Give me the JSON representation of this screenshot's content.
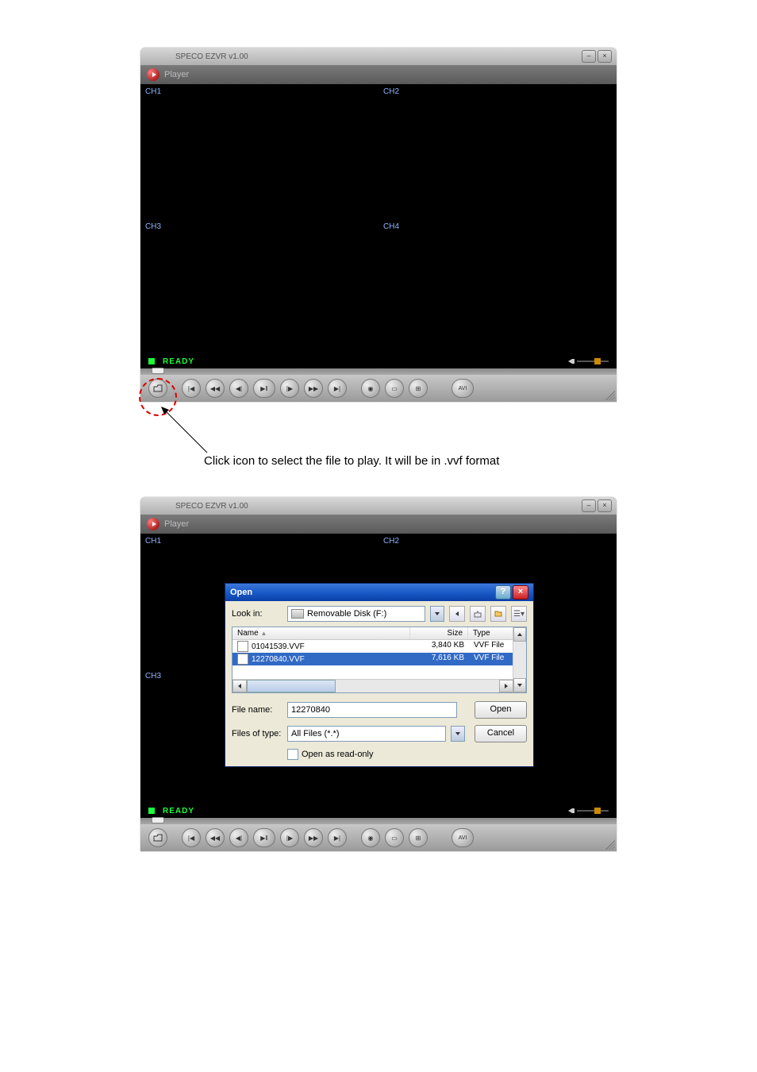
{
  "app": {
    "title": "SPECO EZVR v1.00",
    "player_label": "Player",
    "channels": [
      "CH1",
      "CH2",
      "CH3",
      "CH4"
    ],
    "status": "READY",
    "controls": {
      "open": "open",
      "rew_all": "|◀◀",
      "rew": "◀◀",
      "step_b": "◀|",
      "playpause": "▶/‖",
      "step_f": "|▶",
      "ff": "▶▶",
      "ff_all": "▶▶|",
      "snapshot": "📷",
      "single": "☐",
      "quad": "⊞",
      "avi": "AVI"
    }
  },
  "caption": "Click icon to select the file to play.    It will be in .vvf format",
  "dialog": {
    "title": "Open",
    "look_in_label": "Look in:",
    "look_in_value": "Removable Disk (F:)",
    "columns": {
      "name": "Name",
      "size": "Size",
      "type": "Type"
    },
    "files": [
      {
        "name": "01041539.VVF",
        "size": "3,840 KB",
        "type": "VVF File",
        "selected": false
      },
      {
        "name": "12270840.VVF",
        "size": "7,616 KB",
        "type": "VVF File",
        "selected": true
      }
    ],
    "file_name_label": "File name:",
    "file_name_value": "12270840",
    "files_of_type_label": "Files of type:",
    "files_of_type_value": "All Files (*.*)",
    "open_btn": "Open",
    "cancel_btn": "Cancel",
    "readonly_label": "Open as read-only"
  }
}
